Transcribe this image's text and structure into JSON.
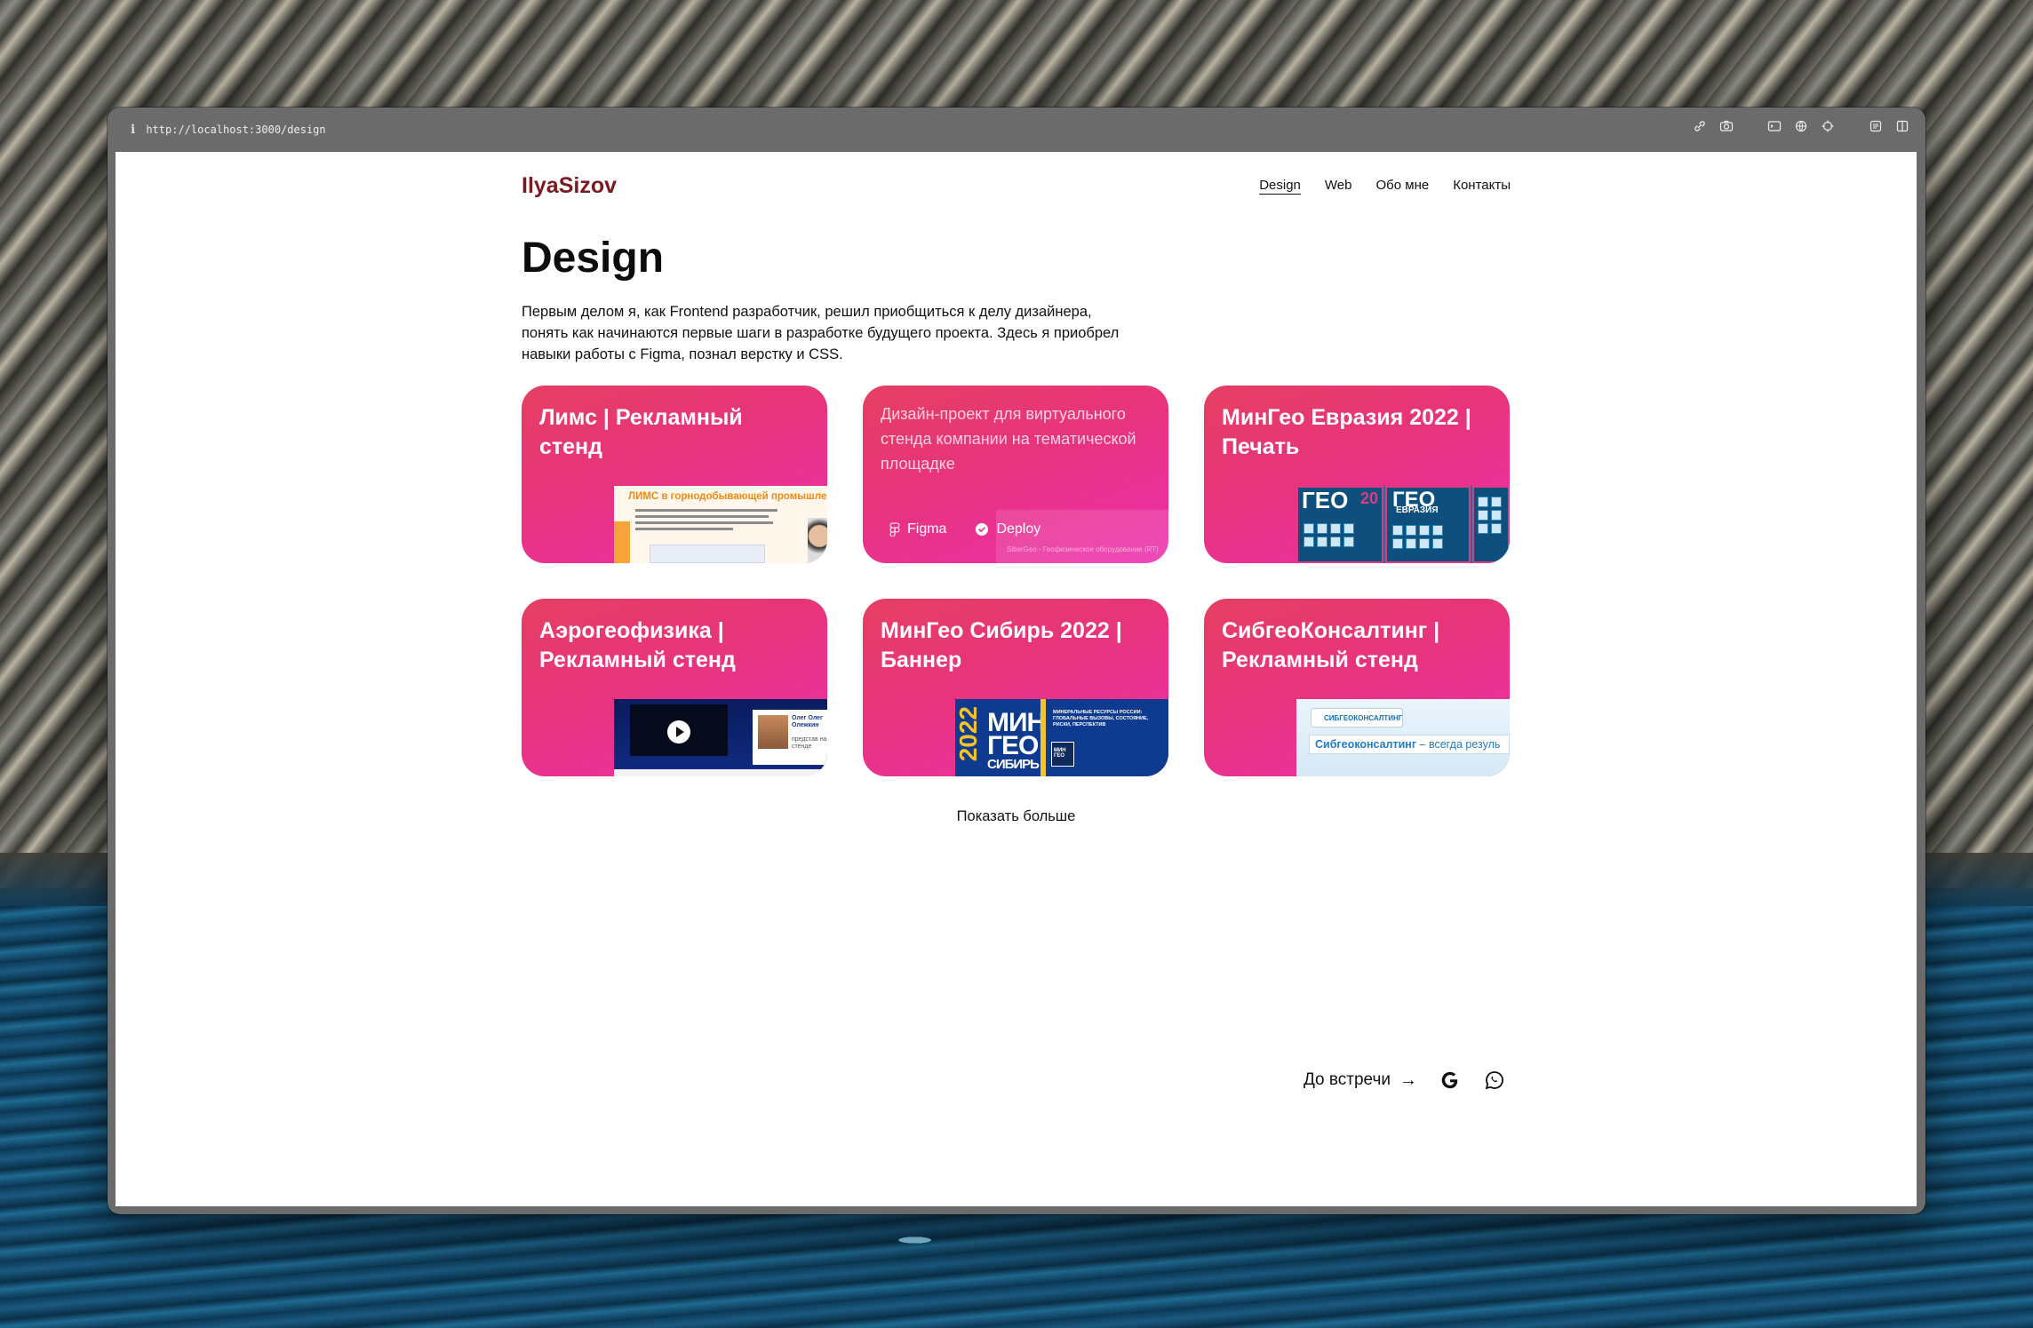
{
  "browser": {
    "info_glyph": "i",
    "url": "http://localhost:3000/design",
    "icons": [
      "link-icon",
      "camera-icon",
      "terminal-icon",
      "globe-icon",
      "crosshair-icon",
      "reader-icon",
      "split-view-icon"
    ]
  },
  "site": {
    "logo": "IlyaSizov",
    "nav": [
      {
        "label": "Design",
        "active": true
      },
      {
        "label": "Web",
        "active": false
      },
      {
        "label": "Обо мне",
        "active": false
      },
      {
        "label": "Контакты",
        "active": false
      }
    ]
  },
  "page": {
    "title": "Design",
    "intro": "Первым делом я, как Frontend разработчик, решил приобщиться к делу дизайнера, понять как начинаются первые шаги в разработке будущего проекта. Здесь я приобрел навыки работы с Figma, познал верстку и CSS."
  },
  "cards": [
    {
      "title": "Лимс | Рекламный стенд",
      "thumb": {
        "heading": "ЛИМС в горнодобывающей промышлен",
        "text": "ЛИМС позволяет существенно сократить время и затраты на ведение лабораторного документооборота, а также существенно уменьшить влияние человеческого фактора и повысить качество результатов"
      }
    },
    {
      "description": "Дизайн-проект для виртуального стенда компании на тематической площадке",
      "tags": [
        {
          "label": "Figma",
          "icon": "figma-icon"
        },
        {
          "label": "Deploy",
          "icon": "check-circle-icon"
        }
      ],
      "thumb": {
        "text": "SiberGeo - Геофизическое оборудование (RT)"
      }
    },
    {
      "title": "МинГео Евразия 2022 | Печать",
      "thumb": {
        "big": "ГЕО",
        "small": "ЕВРАЗИЯ",
        "year": "20"
      }
    },
    {
      "title": "Аэрогеофизика | Рекламный стенд",
      "thumb": {
        "name": "Олег Олег Олежкин",
        "sub": "представ на стенде"
      }
    },
    {
      "title": "МинГео Сибирь 2022 | Баннер",
      "thumb": {
        "year": "2022",
        "line1": "МИН",
        "line2": "ГЕО",
        "line3": "СИБИРЬ",
        "info": "МИНЕРАЛЬНЫЕ РЕСУРСЫ РОССИИ: ГЛОБАЛЬНЫЕ ВЫЗОВЫ, СОСТОЯНИЕ, РИСКИ, ПЕРСПЕКТИВ",
        "logo": "МИН ГЕО"
      }
    },
    {
      "title": "СибгеоКонсалтинг | Рекламный стенд",
      "thumb": {
        "logo": "СИБГЕОКОНСАЛТИНГ",
        "line_bold": "Сибгеоконсалтинг",
        "line_rest": " – всегда резуль"
      }
    }
  ],
  "show_more": "Показать больше",
  "footer": {
    "farewell": "До встречи",
    "arrow": "→",
    "icons": [
      "google-icon",
      "whatsapp-icon"
    ]
  },
  "colors": {
    "logo": "#7a1a1f",
    "card_gradient_start": "#e53f62",
    "card_gradient_end": "#ec2fb0",
    "browser_chrome": "#6b6b6b"
  }
}
